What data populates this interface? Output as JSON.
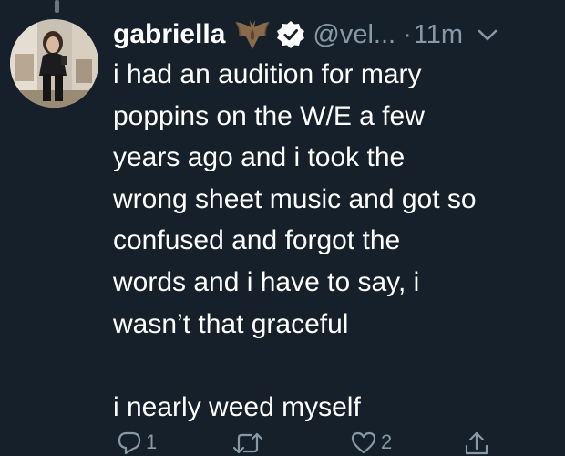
{
  "user": {
    "display_name": "gabriella",
    "handle": "@vel...",
    "time_prefix": "·",
    "time": "11m"
  },
  "tweet": {
    "lines": [
      "i had an audition for mary",
      "poppins on the W/E a few",
      "years ago and i took the",
      "wrong sheet music and got so",
      "confused and forgot the",
      "words and i have to say, i",
      "wasn’t that graceful",
      "",
      "i nearly weed myself"
    ]
  },
  "actions": {
    "reply_count": "1",
    "retweet_count": "",
    "like_count": "2"
  },
  "icons": {
    "name_emoji": "bat-icon",
    "verified": "verified-badge-icon",
    "menu": "chevron-down-icon",
    "reply": "reply-icon",
    "retweet": "retweet-icon",
    "like": "heart-icon",
    "share": "share-icon"
  },
  "colors": {
    "background": "#15202b",
    "text": "#ffffff",
    "secondary_text": "#8899a6",
    "thread_line": "#6e767d"
  }
}
